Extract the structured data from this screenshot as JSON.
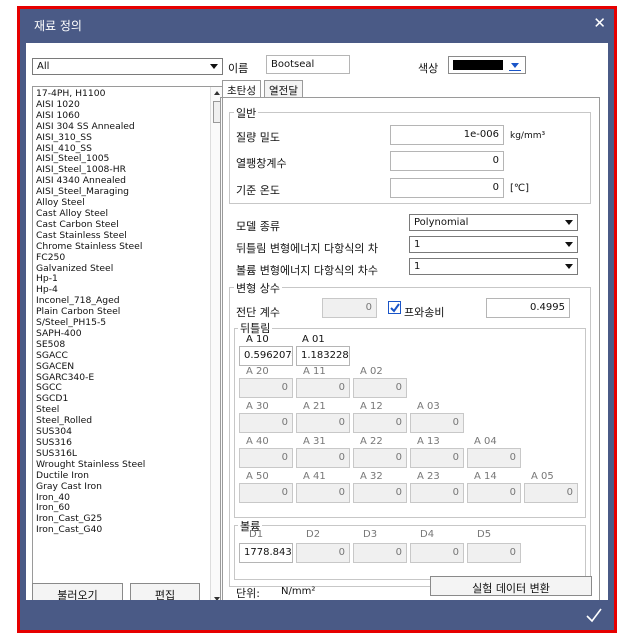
{
  "window": {
    "title": "재료 정의",
    "close": "✕"
  },
  "filter": {
    "selected": "All"
  },
  "materials": [
    "17-4PH, H1100",
    "AISI 1020",
    "AISI 1060",
    "AISI 304 SS Annealed",
    "AISI_310_SS",
    "AISI_410_SS",
    "AISI_Steel_1005",
    "AISI_Steel_1008-HR",
    "AISI 4340 Annealed",
    "AISI_Steel_Maraging",
    "Alloy Steel",
    "Cast Alloy Steel",
    "Cast Carbon Steel",
    "Cast Stainless Steel",
    "Chrome Stainless Steel",
    "FC250",
    "Galvanized Steel",
    "Hp-1",
    "Hp-4",
    "Inconel_718_Aged",
    "Plain Carbon Steel",
    "S/Steel_PH15-5",
    "SAPH-400",
    "SE508",
    "SGACC",
    "SGACEN",
    "SGARC340-E",
    "SGCC",
    "SGCD1",
    "Steel",
    "Steel_Rolled",
    "SUS304",
    "SUS316",
    "SUS316L",
    "Wrought Stainless Steel",
    "Ductile Iron",
    "Gray Cast Iron",
    "Iron_40",
    "Iron_60",
    "Iron_Cast_G25",
    "Iron_Cast_G40"
  ],
  "buttons": {
    "load": "불러오기",
    "edit": "편집",
    "convert": "실험 데이터 변환"
  },
  "name": {
    "label": "이름",
    "value": "Bootseal"
  },
  "color": {
    "label": "색상",
    "value": "#000000"
  },
  "tabs": [
    {
      "label": "초탄성",
      "active": true
    },
    {
      "label": "열전달",
      "active": false
    }
  ],
  "general": {
    "title": "일반",
    "density": {
      "label": "질량 밀도",
      "value": "1e-006",
      "unit": "kg/mm³"
    },
    "expansion": {
      "label": "열팽창계수",
      "value": "0"
    },
    "ref_temp": {
      "label": "기준 온도",
      "value": "0",
      "unit": "[℃]"
    }
  },
  "model_type": {
    "label": "모델 종류",
    "value": "Polynomial"
  },
  "distortion_order": {
    "label": "뒤틀림 변형에너지 다항식의 차",
    "value": "1"
  },
  "volume_order": {
    "label": "볼륨 변형에너지 다항식의 차수",
    "value": "1"
  },
  "constants": {
    "title": "변형 상수",
    "shear_label": "전단 계수",
    "shear_value": "0",
    "poisson_label": "프와송비",
    "poisson_checked": true,
    "poisson_value": "0.4995",
    "distortion": {
      "title": "뒤틀림",
      "a10": {
        "label": "A 10",
        "value": "0.596207€"
      },
      "a01": {
        "label": "A 01",
        "value": "1.183228€"
      },
      "rows": [
        {
          "labels": [
            "A 20",
            "A 11",
            "A 02"
          ],
          "values": [
            "0",
            "0",
            "0"
          ]
        },
        {
          "labels": [
            "A 30",
            "A 21",
            "A 12",
            "A 03"
          ],
          "values": [
            "0",
            "0",
            "0",
            "0"
          ]
        },
        {
          "labels": [
            "A 40",
            "A 31",
            "A 22",
            "A 13",
            "A 04"
          ],
          "values": [
            "0",
            "0",
            "0",
            "0",
            "0"
          ]
        },
        {
          "labels": [
            "A 50",
            "A 41",
            "A 32",
            "A 23",
            "A 14",
            "A 05"
          ],
          "values": [
            "0",
            "0",
            "0",
            "0",
            "0",
            "0"
          ]
        }
      ]
    },
    "volume": {
      "title": "볼륨",
      "labels": [
        "D1",
        "D2",
        "D3",
        "D4",
        "D5"
      ],
      "values": [
        "1778.8431",
        "0",
        "0",
        "0",
        "0"
      ]
    }
  },
  "unit": {
    "label": "단위:",
    "value": "N/mm²"
  },
  "colors": {
    "titlebar": "#4a5a86",
    "frame_border": "#e60000",
    "accent": "#1a55c8"
  }
}
